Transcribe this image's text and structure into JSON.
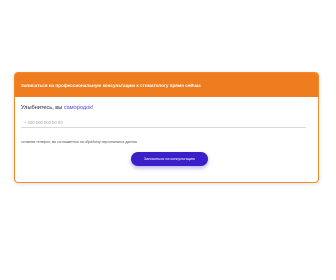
{
  "form": {
    "header_title": "Записаться на профессиональную консультацию к стоматологу прямо сейчас",
    "prompt_text": "Улыбнитесь, вы ",
    "prompt_brand": "самородок!",
    "phone_placeholder": "+ 000 000 000 00 00",
    "consent_text": "оставляя телефон, вы соглашаетесь на обработку персональных данных",
    "submit_label": "Записаться на консультацию"
  },
  "colors": {
    "header_bg": "#ef7d1f",
    "border": "#f08a2c",
    "button_bg": "#3a20c8",
    "brand_text": "#5a3fd8"
  }
}
